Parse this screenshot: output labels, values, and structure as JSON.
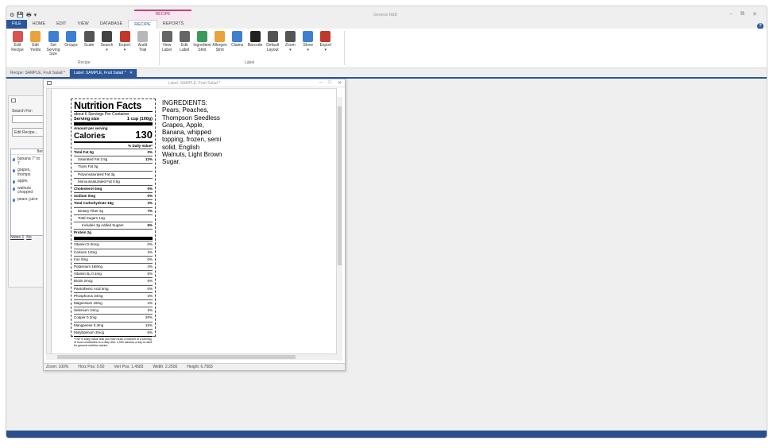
{
  "app": {
    "title": "Genesis R&D",
    "qat": [
      "⚙",
      "💾",
      "🖶",
      "▾"
    ],
    "window_controls": [
      "–",
      "⧉",
      "✕"
    ],
    "help": "?"
  },
  "ribbon": {
    "context_header": "RECIPE",
    "tabs": [
      "FILE",
      "HOME",
      "EDIT",
      "VIEW",
      "DATABASE",
      "RECIPE",
      "REPORTS"
    ],
    "recipe_group": {
      "label": "Recipe",
      "buttons": [
        {
          "id": "edit-recipe",
          "l1": "Edit",
          "l2": "Recipe",
          "color": "#d9534f"
        },
        {
          "id": "edit-yields",
          "l1": "Edit",
          "l2": "Yields",
          "color": "#e8a33d"
        },
        {
          "id": "set-serving-size",
          "l1": "Set Serving",
          "l2": "Size",
          "color": "#3d7fd1"
        },
        {
          "id": "groups",
          "l1": "Groups",
          "l2": "",
          "color": "#3d7fd1"
        },
        {
          "id": "scale",
          "l1": "Scale",
          "l2": "",
          "color": "#555555"
        },
        {
          "id": "search",
          "l1": "Search",
          "l2": "▾",
          "color": "#444444"
        },
        {
          "id": "export",
          "l1": "Export",
          "l2": "▾",
          "color": "#c0392b"
        },
        {
          "id": "audit-trail",
          "l1": "Audit",
          "l2": "Trail",
          "color": "#b8b8b8"
        }
      ]
    },
    "label_group": {
      "label": "Label",
      "buttons": [
        {
          "id": "view-label",
          "l1": "View",
          "l2": "Label",
          "color": "#666666"
        },
        {
          "id": "edit-label",
          "l1": "Edit",
          "l2": "Label",
          "color": "#666666"
        },
        {
          "id": "ingredient-stmt",
          "l1": "Ingredient",
          "l2": "Stmt",
          "color": "#3a9a5b"
        },
        {
          "id": "allergen-stmt",
          "l1": "Allergen",
          "l2": "Stmt",
          "color": "#e8a33d"
        },
        {
          "id": "claims",
          "l1": "Claims",
          "l2": "",
          "color": "#3d7fd1"
        },
        {
          "id": "barcode",
          "l1": "Barcode",
          "l2": "",
          "color": "#222222"
        },
        {
          "id": "default-layout",
          "l1": "Default",
          "l2": "Layout",
          "color": "#555555"
        },
        {
          "id": "zoom",
          "l1": "Zoom",
          "l2": "▾",
          "color": "#555555"
        },
        {
          "id": "show",
          "l1": "Show",
          "l2": "▾",
          "color": "#3d7fd1"
        },
        {
          "id": "export-label",
          "l1": "Export",
          "l2": "▾",
          "color": "#c0392b"
        }
      ]
    }
  },
  "doc_tabs": [
    {
      "label": "Recipe: SAMPLE, Fruit Salad *",
      "active": false
    },
    {
      "label": "Label: SAMPLE, Fruit Salad *",
      "active": true
    }
  ],
  "left_panel": {
    "search_label": "Search For:",
    "edit_button": "Edit Recipe...",
    "list_header": "Iter",
    "items": [
      "banana 7\" to 7",
      "grapes, thomps",
      "apple,",
      "walnuts chopped",
      "pears, juice"
    ],
    "bottom_tabs": [
      "Notes 1",
      "No"
    ]
  },
  "label_window": {
    "title": "Label: SAMPLE, Fruit Salad *",
    "controls": [
      "–",
      "□",
      "✕"
    ],
    "status": {
      "zoom": "Zoom:  100%",
      "horz": "Horz Pos:  0.50",
      "vert": "Vert Pos:  1.4583",
      "width": "Width:  2.2500",
      "height": "Height:  6.7583"
    }
  },
  "nutrition_facts": {
    "title": "Nutrition Facts",
    "servings": "about 6 Servings Per Container",
    "serving_size_label": "Serving size",
    "serving_size_value": "1 cup (100g)",
    "amount_per_serving": "Amount per serving",
    "calories_label": "Calories",
    "calories_value": "130",
    "dv_header": "% Daily Value*",
    "rows": [
      {
        "name": "Total Fat 0g",
        "dv": "0%",
        "bold": true,
        "indent": 0
      },
      {
        "name": "Saturated Fat 2.5g",
        "dv": "12%",
        "bold": false,
        "indent": 1
      },
      {
        "name": "Trans Fat 0g",
        "dv": "",
        "bold": false,
        "indent": 1
      },
      {
        "name": "Polyunsaturated Fat 3g",
        "dv": "",
        "bold": false,
        "indent": 1
      },
      {
        "name": "Monounsaturated Fat 0.5g",
        "dv": "",
        "bold": false,
        "indent": 1
      },
      {
        "name": "Cholesterol 0mg",
        "dv": "0%",
        "bold": true,
        "indent": 0
      },
      {
        "name": "Sodium 0mg",
        "dv": "0%",
        "bold": true,
        "indent": 0
      },
      {
        "name": "Total Carbohydrate 18g",
        "dv": "3%",
        "bold": true,
        "indent": 0
      },
      {
        "name": "Dietary Fiber 2g",
        "dv": "7%",
        "bold": false,
        "indent": 1
      },
      {
        "name": "Total Sugars 14g",
        "dv": "",
        "bold": false,
        "indent": 1
      },
      {
        "name": "Includes 3g Added Sugars",
        "dv": "6%",
        "bold": false,
        "indent": 2
      },
      {
        "name": "Protein 2g",
        "dv": "",
        "bold": true,
        "indent": 0
      }
    ],
    "micros": [
      {
        "name": "Vitamin D 0mcg",
        "dv": "0%"
      },
      {
        "name": "Calcium 13mg",
        "dv": "2%"
      },
      {
        "name": "Iron 0mg",
        "dv": "0%"
      },
      {
        "name": "Potassium 168mg",
        "dv": "4%"
      },
      {
        "name": "Vitamin B₆ 0.1mg",
        "dv": "6%"
      },
      {
        "name": "Biotin 2mcg",
        "dv": "6%"
      },
      {
        "name": "Pantothenic Acid 0mg",
        "dv": "0%"
      },
      {
        "name": "Phosphorus 34mg",
        "dv": "3%"
      },
      {
        "name": "Magnesium 18mg",
        "dv": "4%"
      },
      {
        "name": "Selenium 1mcg",
        "dv": "2%"
      },
      {
        "name": "Copper 0.2mg",
        "dv": "20%"
      },
      {
        "name": "Manganese 0.3mg",
        "dv": "15%"
      },
      {
        "name": "Molybdenum 3mcg",
        "dv": "6%"
      }
    ],
    "footnote": "*The % Daily Value tells you how much a nutrient in a serving of food contributes to a daily diet. 2,000 calories a day is used for general nutrition advice."
  },
  "ingredients": {
    "text": "INGREDIENTS: Pears, Peaches, Thompson Seedless Grapes, Apple, Banana, whipped topping, frozen, semi solid, English Walnuts, Light Brown Sugar."
  }
}
